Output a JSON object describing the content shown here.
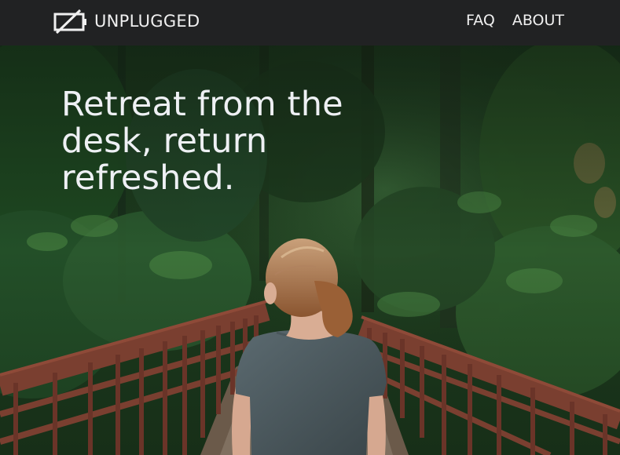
{
  "nav": {
    "brand": "UNPLUGGED",
    "links": [
      "FAQ",
      "ABOUT"
    ]
  },
  "hero": {
    "headline": "Retreat from the desk, return refreshed."
  },
  "icons": {
    "logo": "unplugged-battery-icon"
  },
  "colors": {
    "navbar": "#212223",
    "text": "#f0f0f0",
    "forest": "#20401f",
    "railing": "#7a3f30"
  }
}
